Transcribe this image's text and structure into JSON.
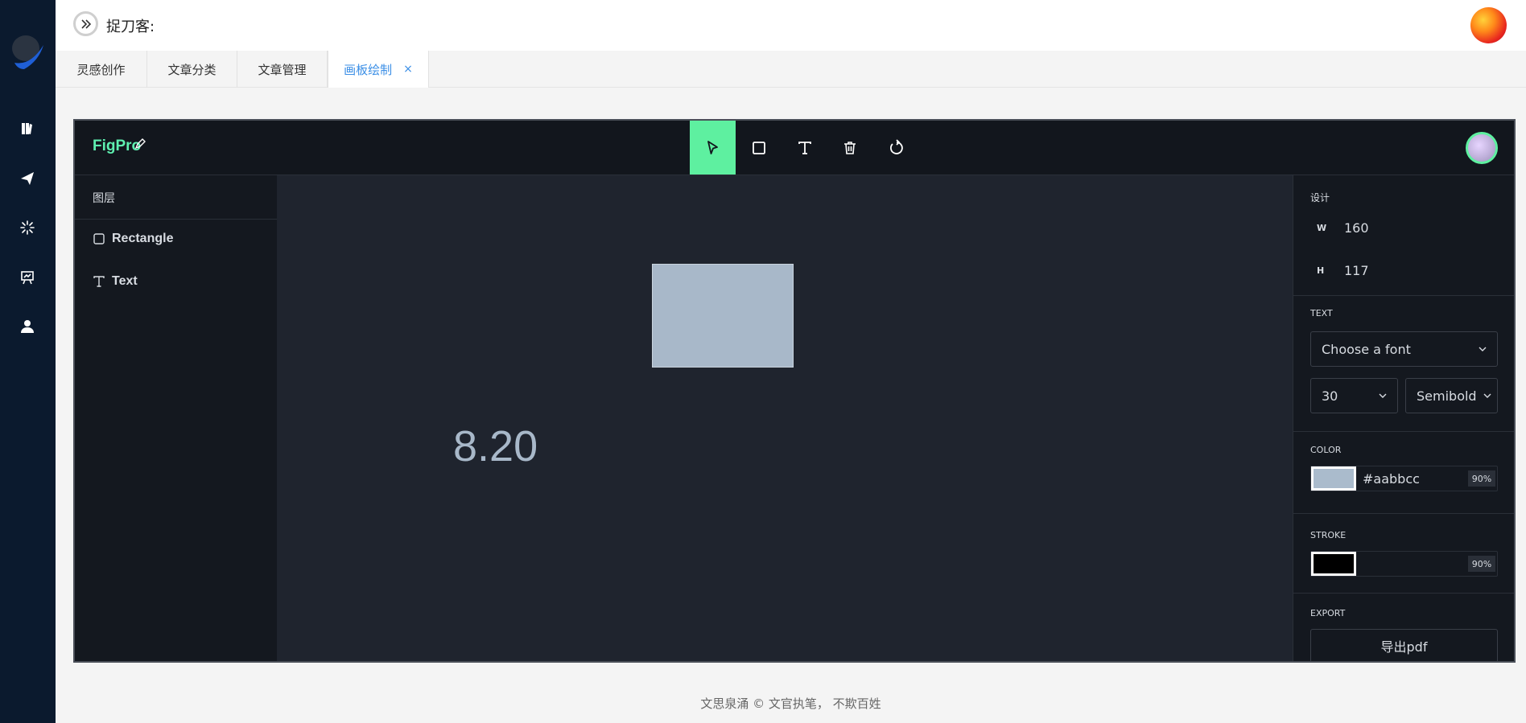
{
  "header": {
    "title": "捉刀客:"
  },
  "sidebar": {
    "items": [
      {
        "icon": "book-icon"
      },
      {
        "icon": "send-icon"
      },
      {
        "icon": "sparkle-icon"
      },
      {
        "icon": "presentation-icon"
      },
      {
        "icon": "user-icon"
      }
    ]
  },
  "tabs": [
    {
      "label": "灵感创作"
    },
    {
      "label": "文章分类"
    },
    {
      "label": "文章管理"
    },
    {
      "label": "画板绘制",
      "close": "×"
    }
  ],
  "editor": {
    "brand": "FigPro",
    "tools": [
      "select-tool-icon",
      "rectangle-tool-icon",
      "text-tool-icon",
      "delete-icon",
      "reset-icon"
    ],
    "layers": {
      "title": "图层",
      "items": [
        {
          "label": "Rectangle",
          "icon": "square-icon"
        },
        {
          "label": "Text",
          "icon": "text-icon"
        }
      ]
    },
    "canvas": {
      "text_value": "8.20",
      "rect_fill": "#aabbcc"
    },
    "props": {
      "design_title": "设计",
      "w_label": "W",
      "w_value": "160",
      "h_label": "H",
      "h_value": "117",
      "text_title": "TEXT",
      "font_placeholder": "Choose a font",
      "font_size": "30",
      "font_weight": "Semibold",
      "color_title": "COLOR",
      "color_hex": "#aabbcc",
      "color_opacity": "90%",
      "stroke_title": "STROKE",
      "stroke_hex": "",
      "stroke_opacity": "90%",
      "export_title": "EXPORT",
      "export_button": "导出pdf"
    }
  },
  "footer": {
    "text": "文思泉涌 © 文官执笔， 不欺百姓"
  }
}
